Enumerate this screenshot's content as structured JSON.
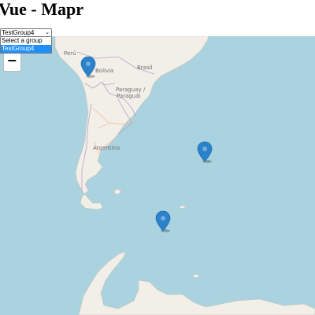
{
  "app": {
    "title": "Vue - Mapr"
  },
  "group_select": {
    "selected": "TestGroup4",
    "options": [
      {
        "label": "Select a group",
        "selected": false
      },
      {
        "label": "TestGroup4",
        "selected": true
      }
    ]
  },
  "map": {
    "labels": {
      "peru": "Perú",
      "bolivia": "Bolivia",
      "brasil": "Brasil",
      "paraguay_line1": "Paraguay /",
      "paraguay_line2": "Paraguái",
      "argentina": "Argentina"
    },
    "zoom_out_label": "−",
    "marker_color": "#2b82cb",
    "ocean_color": "#aad3df",
    "land_color": "#f2efe9",
    "marker_count": 3
  }
}
